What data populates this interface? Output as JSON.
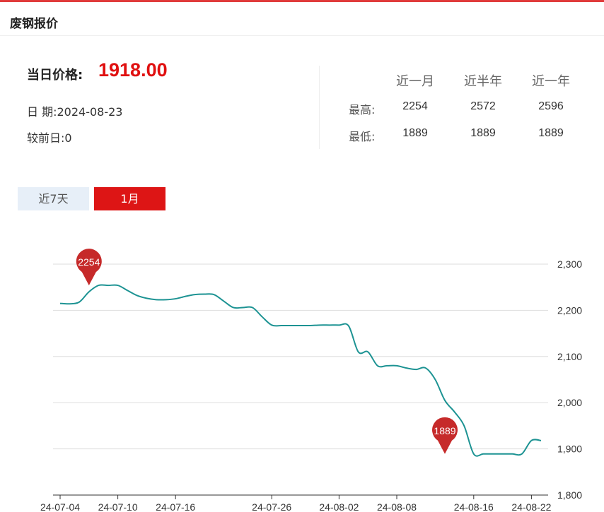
{
  "header": {
    "title": "废钢报价"
  },
  "price": {
    "label": "当日价格:",
    "value": "1918.00",
    "date_line": "日 期:2024-08-23",
    "change_line": "较前日:0"
  },
  "stats": {
    "columns": [
      "近一月",
      "近半年",
      "近一年"
    ],
    "rows": [
      {
        "label": "最高:",
        "values": [
          "2254",
          "2572",
          "2596"
        ]
      },
      {
        "label": "最低:",
        "values": [
          "1889",
          "1889",
          "1889"
        ]
      }
    ]
  },
  "tabs": [
    {
      "label": "近7天",
      "active": false
    },
    {
      "label": "1月",
      "active": true
    }
  ],
  "colors": {
    "line": "#1d9393",
    "pin": "#c62a2a",
    "accent": "#dd1515"
  },
  "chart_data": {
    "type": "line",
    "xlabel": "",
    "ylabel": "",
    "ylim": [
      1800,
      2300
    ],
    "yticks": [
      1800,
      1900,
      2000,
      2100,
      2200,
      2300
    ],
    "ytick_labels": [
      "1,800",
      "1,900",
      "2,000",
      "2,100",
      "2,200",
      "2,300"
    ],
    "xlim": [
      "2024-07-04",
      "2024-08-23"
    ],
    "xticks": [
      "2024-07-04",
      "2024-07-10",
      "2024-07-16",
      "2024-07-26",
      "2024-08-02",
      "2024-08-08",
      "2024-08-16",
      "2024-08-22"
    ],
    "xtick_labels": [
      "24-07-04",
      "24-07-10",
      "24-07-16",
      "24-07-26",
      "24-08-02",
      "24-08-08",
      "24-08-16",
      "24-08-22"
    ],
    "grid": "horizontal",
    "x": [
      "2024-07-04",
      "2024-07-05",
      "2024-07-06",
      "2024-07-07",
      "2024-07-08",
      "2024-07-09",
      "2024-07-10",
      "2024-07-11",
      "2024-07-12",
      "2024-07-13",
      "2024-07-14",
      "2024-07-15",
      "2024-07-16",
      "2024-07-17",
      "2024-07-18",
      "2024-07-19",
      "2024-07-20",
      "2024-07-21",
      "2024-07-22",
      "2024-07-23",
      "2024-07-24",
      "2024-07-25",
      "2024-07-26",
      "2024-07-27",
      "2024-07-28",
      "2024-07-29",
      "2024-07-30",
      "2024-07-31",
      "2024-08-01",
      "2024-08-02",
      "2024-08-03",
      "2024-08-04",
      "2024-08-05",
      "2024-08-06",
      "2024-08-07",
      "2024-08-08",
      "2024-08-09",
      "2024-08-10",
      "2024-08-11",
      "2024-08-12",
      "2024-08-13",
      "2024-08-14",
      "2024-08-15",
      "2024-08-16",
      "2024-08-17",
      "2024-08-18",
      "2024-08-19",
      "2024-08-20",
      "2024-08-21",
      "2024-08-22",
      "2024-08-23"
    ],
    "series": [
      {
        "values": [
          2215,
          2214,
          2218,
          2240,
          2254,
          2254,
          2254,
          2243,
          2232,
          2226,
          2223,
          2223,
          2225,
          2230,
          2234,
          2235,
          2234,
          2220,
          2206,
          2206,
          2206,
          2186,
          2168,
          2167,
          2167,
          2167,
          2167,
          2168,
          2168,
          2168,
          2166,
          2110,
          2110,
          2080,
          2080,
          2080,
          2075,
          2072,
          2075,
          2050,
          2005,
          1980,
          1950,
          1889,
          1889,
          1889,
          1889,
          1889,
          1889,
          1918,
          1918
        ]
      }
    ],
    "annotations": [
      {
        "x": "2024-07-07",
        "y": 2254,
        "label": "2254"
      },
      {
        "x": "2024-08-13",
        "y": 1889,
        "label": "1889"
      }
    ]
  }
}
